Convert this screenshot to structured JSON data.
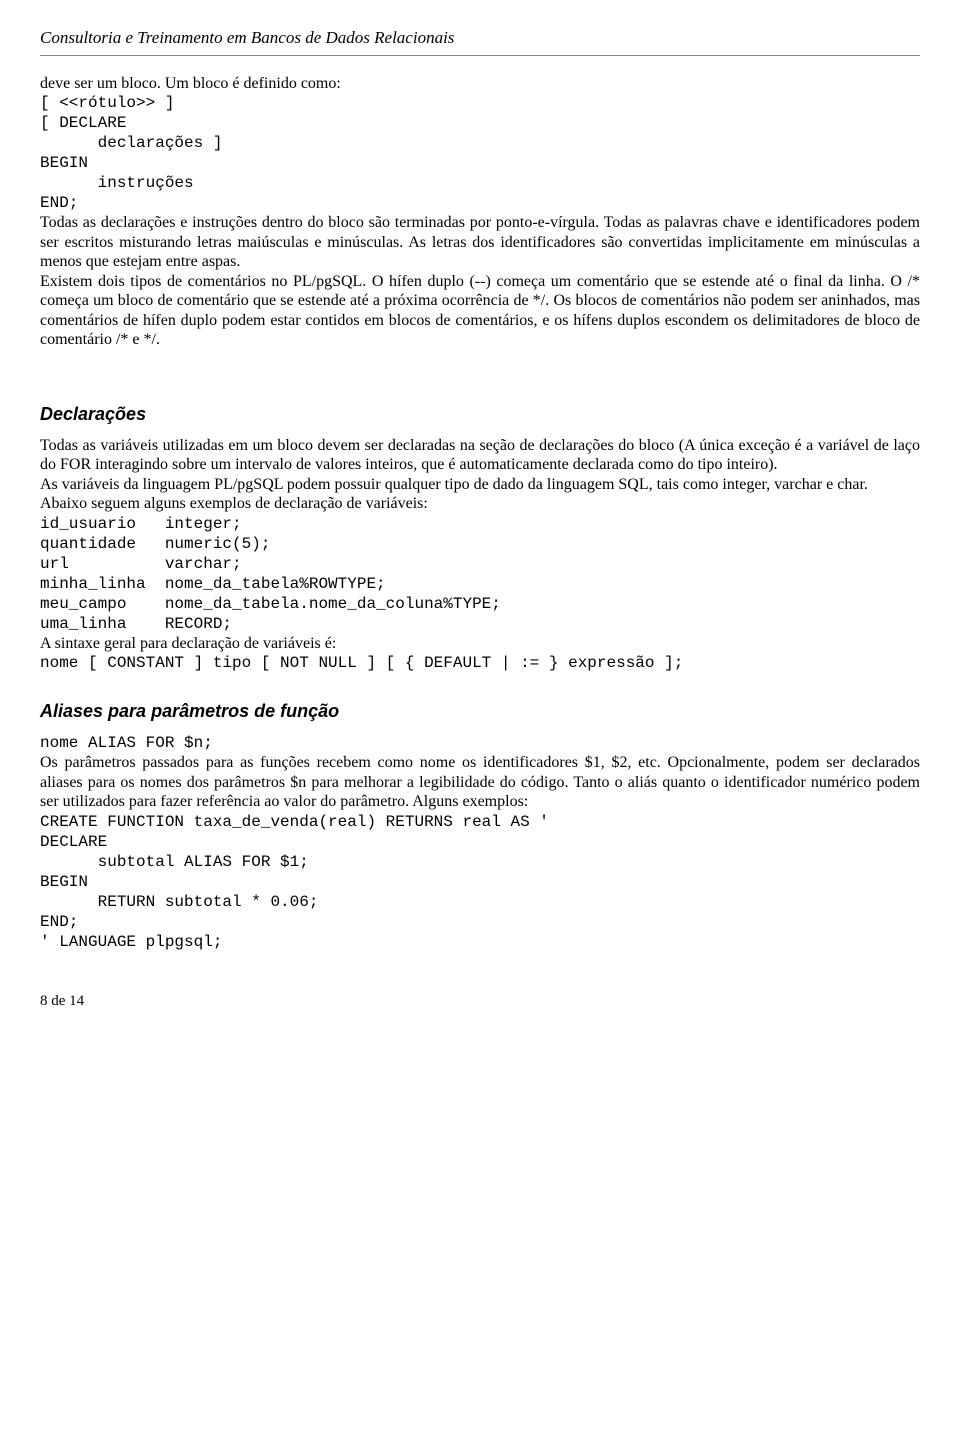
{
  "header": "Consultoria e Treinamento em Bancos de Dados Relacionais",
  "intro_line": "deve ser um bloco. Um bloco é definido como:",
  "code_block1": "[ <<rótulo>> ]\n[ DECLARE\n      declarações ]\nBEGIN\n      instruções\nEND;",
  "para1": "Todas as declarações e instruções dentro do bloco são terminadas por ponto-e-vírgula. Todas as palavras chave e identificadores podem ser escritos misturando letras maiúsculas e minúsculas. As letras dos identificadores são convertidas implicitamente em minúsculas a menos que estejam entre aspas.",
  "para2": "Existem dois tipos de comentários no PL/pgSQL. O hífen duplo (--) começa um comentário que se estende até o final da linha. O /* começa um bloco de comentário que se estende até a próxima ocorrência de */. Os blocos de comentários não podem ser aninhados, mas comentários de hífen duplo podem estar contidos em blocos de comentários, e os hífens duplos escondem os delimitadores de bloco de comentário /* e */.",
  "heading1": "Declarações",
  "decl_para1": "Todas as variáveis utilizadas em um bloco devem ser declaradas na seção de declarações do bloco (A única exceção é a variável de laço do FOR interagindo sobre um intervalo de valores inteiros, que é automaticamente declarada como do tipo inteiro).",
  "decl_para2": "As variáveis da linguagem PL/pgSQL podem possuir qualquer tipo de dado da linguagem SQL, tais como integer, varchar e char.",
  "decl_para3": "Abaixo seguem alguns exemplos de declaração de variáveis:",
  "code_decl": "id_usuario   integer;\nquantidade   numeric(5);\nurl          varchar;\nminha_linha  nome_da_tabela%ROWTYPE;\nmeu_campo    nome_da_tabela.nome_da_coluna%TYPE;\numa_linha    RECORD;",
  "decl_para4": "A sintaxe geral para declaração de variáveis é:",
  "code_syntax": "nome [ CONSTANT ] tipo [ NOT NULL ] [ { DEFAULT | := } expressão ];",
  "heading2": "Aliases para parâmetros de função",
  "alias_code1": "nome ALIAS FOR $n;",
  "alias_para1": "Os parâmetros passados para as funções recebem como nome os identificadores $1, $2, etc. Opcionalmente, podem ser declarados aliases para os nomes dos parâmetros $n para melhorar a legibilidade do código. Tanto o aliás quanto o identificador numérico podem ser utilizados para fazer referência ao valor do parâmetro. Alguns exemplos:",
  "alias_code2": "CREATE FUNCTION taxa_de_venda(real) RETURNS real AS '\nDECLARE\n      subtotal ALIAS FOR $1;\nBEGIN\n      RETURN subtotal * 0.06;\nEND;\n' LANGUAGE plpgsql;",
  "footer": "8 de 14"
}
